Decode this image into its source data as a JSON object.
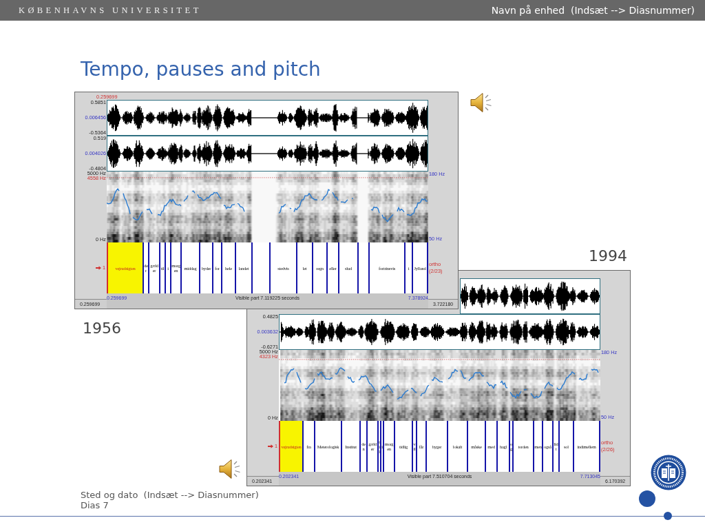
{
  "header": {
    "university": "KØBENHAVNS UNIVERSITET",
    "unit": "Navn på enhed  (Indsæt --> Diasnummer)"
  },
  "title": "Tempo, pauses and pitch",
  "recordings": [
    {
      "year": "1956",
      "window": {
        "cursor_time": "0.259699",
        "channels": [
          {
            "max": "0.5851",
            "mid": "0.006456",
            "min": "-0.5364"
          },
          {
            "max": "0.519",
            "mid": "0.004026",
            "min": "-0.4804"
          }
        ],
        "spectrogram": {
          "top": "5000 Hz",
          "marker": "4558 Hz",
          "bottom": "0 Hz",
          "pitch_top": "180 Hz",
          "pitch_bottom": "50 Hz"
        },
        "tier": {
          "number": "1",
          "name": "ortho",
          "count": "(2/23)",
          "intervals": [
            {
              "text": "vejrudsigten",
              "selected": true
            },
            {
              "text": "der",
              "selected": false
            },
            {
              "text": "gælder",
              "selected": false
            },
            {
              "text": "til",
              "selected": false
            },
            {
              "text": "i",
              "selected": false
            },
            {
              "text": "morgen",
              "selected": false
            },
            {
              "text": "middag",
              "selected": false
            },
            {
              "text": "byder",
              "selected": false
            },
            {
              "text": "for",
              "selected": false
            },
            {
              "text": "hele",
              "selected": false
            },
            {
              "text": "landet",
              "selected": false
            },
            {
              "selected": false
            },
            {
              "text": "stedvis",
              "selected": false
            },
            {
              "text": "let",
              "selected": false
            },
            {
              "text": "regn",
              "selected": false
            },
            {
              "text": "eller",
              "selected": false
            },
            {
              "text": "slud",
              "selected": false
            },
            {
              "selected": false
            },
            {
              "text": "fortrinsvis",
              "selected": false
            },
            {
              "text": "i",
              "selected": false
            },
            {
              "text": "Jylland",
              "selected": false
            }
          ]
        },
        "time_start": "0.259699",
        "visible": "Visible part 7.119225 seconds",
        "time_end": "7.378924",
        "window_start": "0.259699",
        "total": "3.722180"
      }
    },
    {
      "year": "1994",
      "window": {
        "channels": [
          {
            "max": "0.4825",
            "mid": "0.003632",
            "min": "-0.6271"
          }
        ],
        "spectrogram": {
          "top": "5000 Hz",
          "marker": "4323 Hz",
          "bottom": "0 Hz",
          "pitch_top": "180 Hz",
          "pitch_bottom": "50 Hz"
        },
        "tier": {
          "number": "1",
          "name": "ortho",
          "count": "(2/26)",
          "intervals": [
            {
              "text": "vejrudsigten",
              "selected": true
            },
            {
              "text": "fra",
              "selected": false
            },
            {
              "text": "Meterologisk",
              "selected": false
            },
            {
              "text": "Institut",
              "selected": false
            },
            {
              "text": "den",
              "selected": false
            },
            {
              "text": "gælder",
              "selected": false
            },
            {
              "text": "til",
              "selected": false
            },
            {
              "text": "i",
              "selected": false
            },
            {
              "text": "morgen",
              "selected": false
            },
            {
              "text": "tidlig",
              "selected": false
            },
            {
              "text": "vil",
              "selected": false
            },
            {
              "text": "får",
              "selected": false
            },
            {
              "text": "byger",
              "selected": false
            },
            {
              "text": "lokalt",
              "selected": false
            },
            {
              "text": "måske",
              "selected": false
            },
            {
              "text": "med",
              "selected": false
            },
            {
              "text": "hagl",
              "selected": false
            },
            {
              "text": "og",
              "selected": false
            },
            {
              "text": "torden",
              "selected": false
            },
            {
              "text": "men",
              "selected": false
            },
            {
              "text": "også",
              "selected": false
            },
            {
              "text": "lidt",
              "selected": false
            },
            {
              "text": "sol",
              "selected": false
            },
            {
              "text": "indimellem",
              "selected": false
            }
          ]
        },
        "time_start": "0.202341",
        "visible": "Visible part 7.510704 seconds",
        "time_end": "7.713045",
        "window_start": "0.202341",
        "total": "6.170392"
      }
    }
  ],
  "footer": {
    "place_date": "Sted og dato  (Indsæt --> Diasnummer)",
    "slide": "Dias 7"
  }
}
